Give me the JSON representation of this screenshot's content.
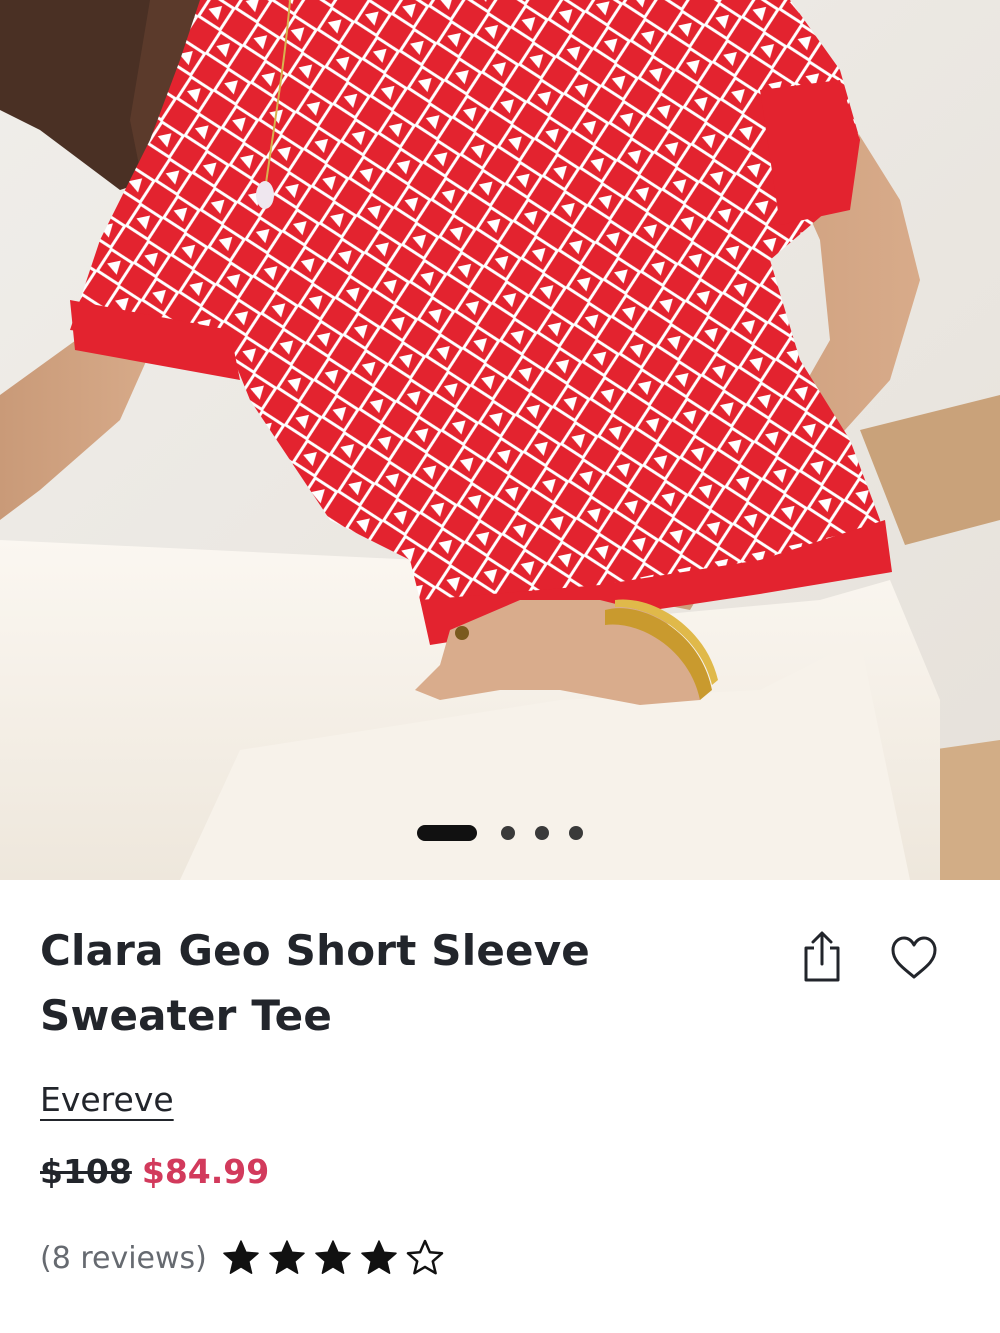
{
  "carousel": {
    "slide_count": 4,
    "active_index": 0
  },
  "product": {
    "title": "Clara Geo Short Sleeve Sweater Tee",
    "brand": "Evereve",
    "original_price": "$108",
    "sale_price": "$84.99",
    "reviews_label": "(8 reviews)",
    "rating": 4,
    "rating_max": 5
  },
  "actions": {
    "share_icon": "share-icon",
    "favorite_icon": "heart-outline-icon"
  },
  "colors": {
    "sale_price": "#d23a5c",
    "text": "#22252b",
    "muted": "#666a70",
    "sweater_red": "#e3232f"
  }
}
